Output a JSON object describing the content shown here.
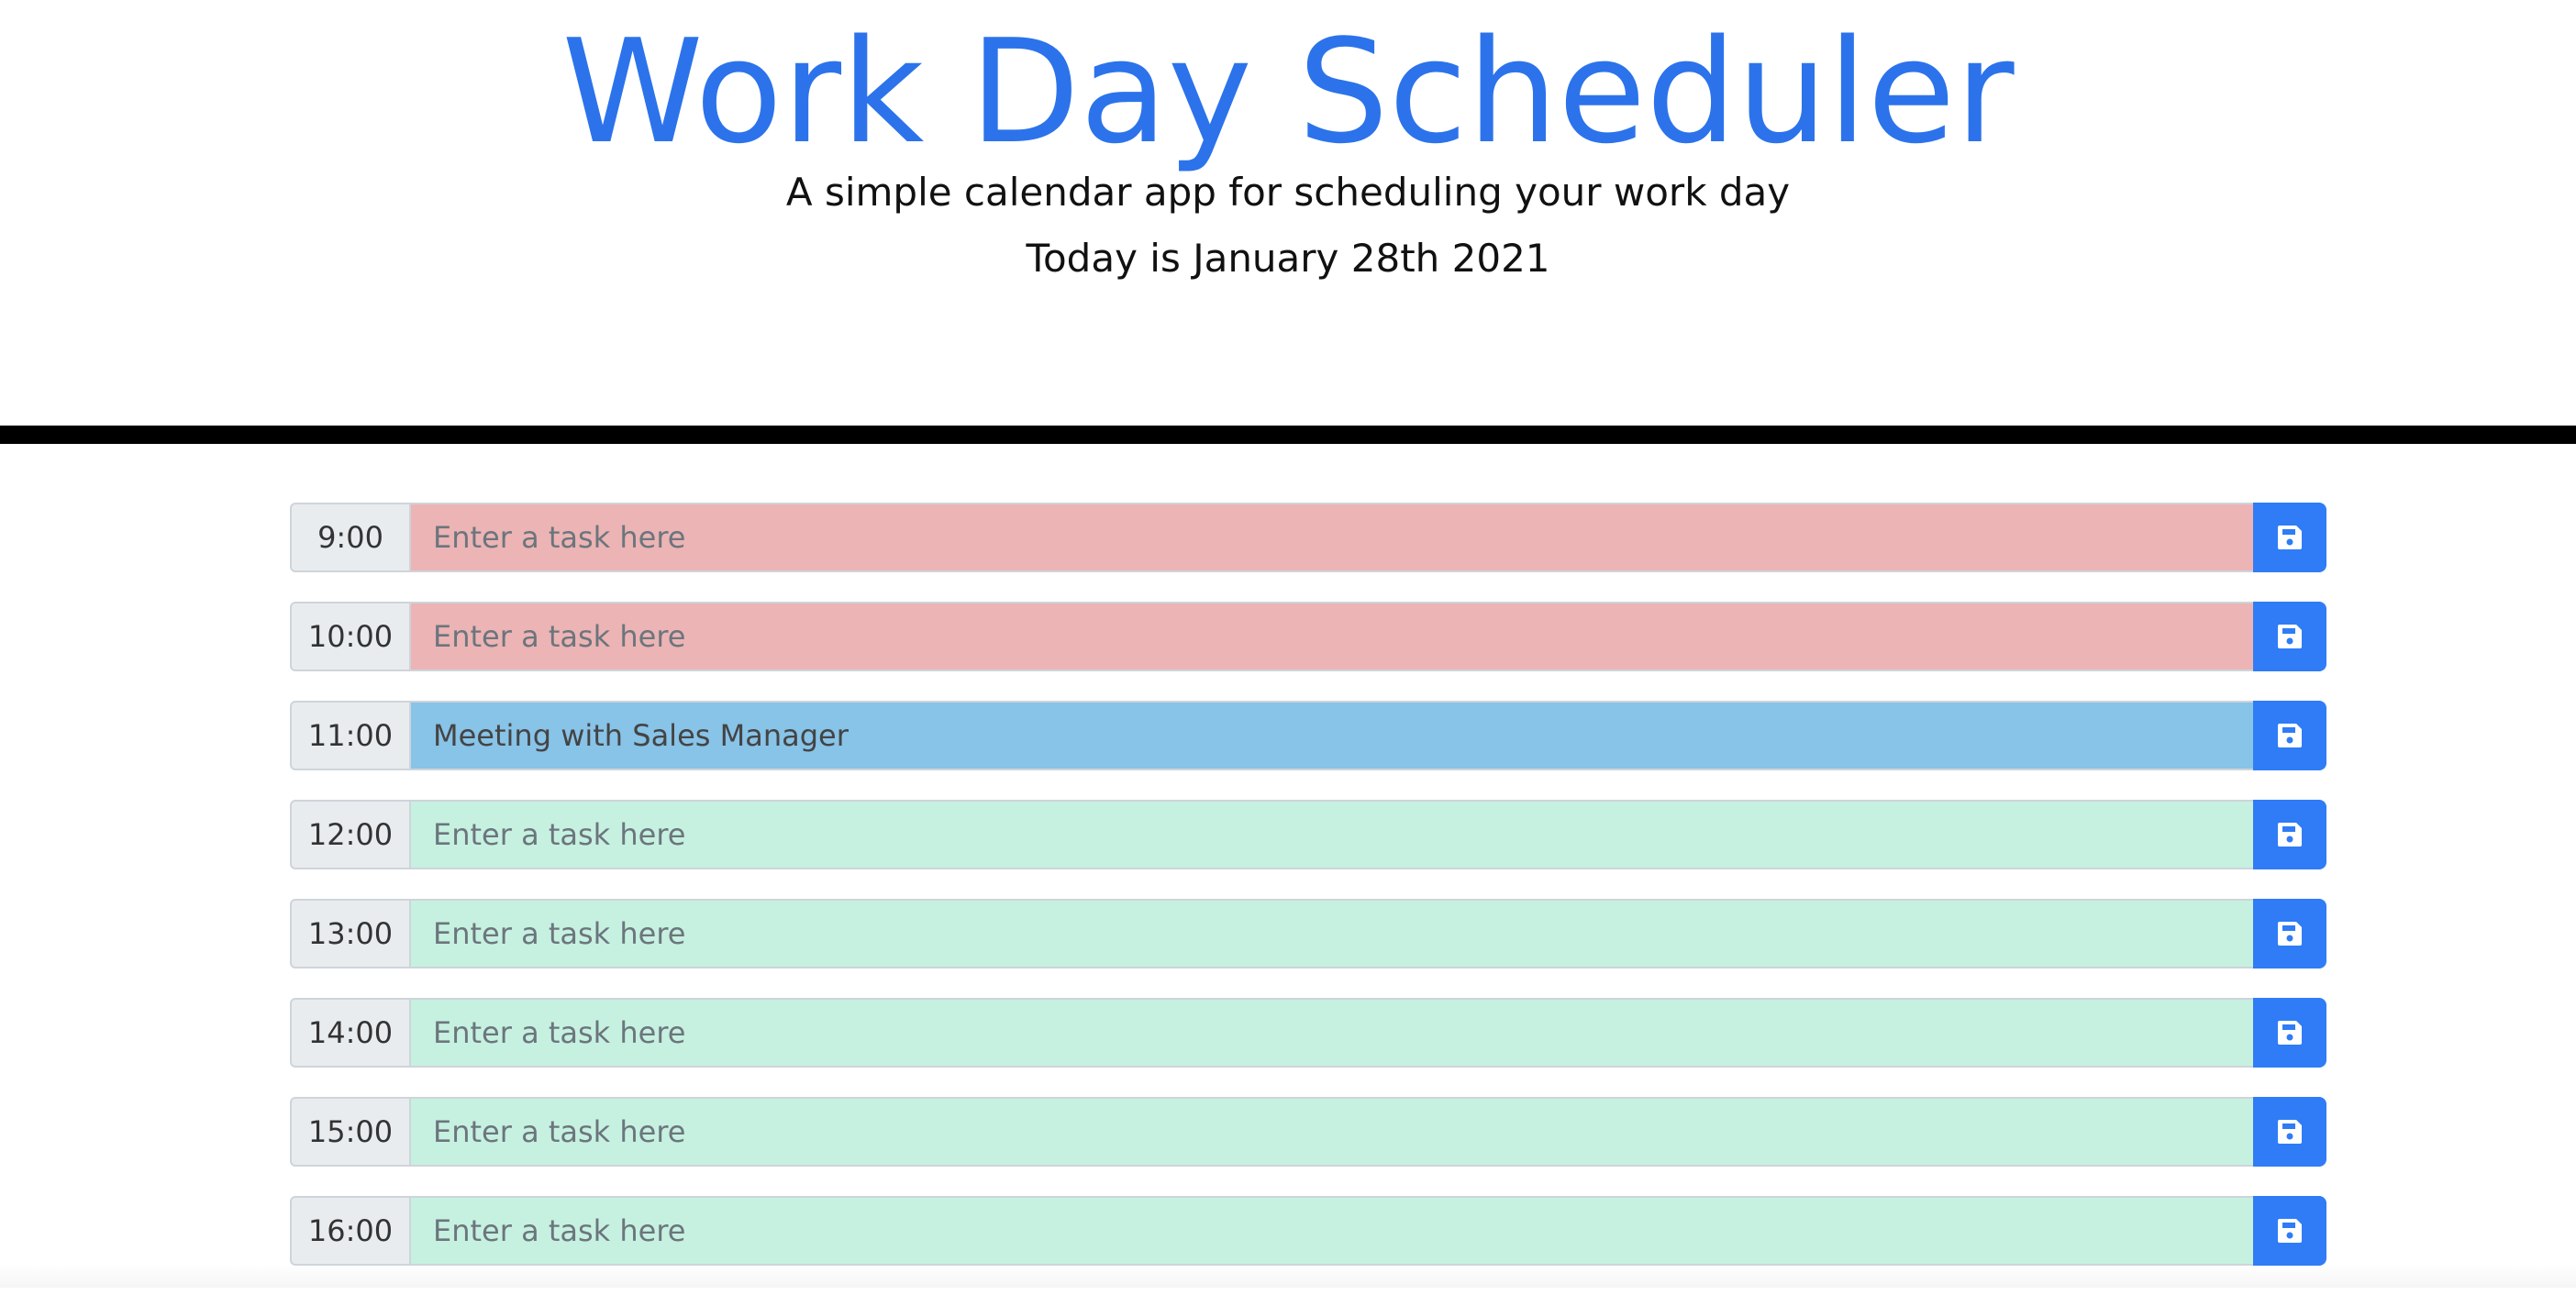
{
  "header": {
    "title": "Work Day Scheduler",
    "subtitle": "A simple calendar app for scheduling your work day",
    "today": "Today is January 28th 2021"
  },
  "colors": {
    "title": "#2c73eb",
    "past": "#ecb4b4",
    "present": "#88c3e8",
    "future": "#c6f1e0",
    "save_button": "#2f7cf6"
  },
  "rows": [
    {
      "hour": "9:00",
      "value": "",
      "placeholder": "Enter a task here",
      "state": "past",
      "save_icon": "floppy-disk-icon"
    },
    {
      "hour": "10:00",
      "value": "",
      "placeholder": "Enter a task here",
      "state": "past",
      "save_icon": "floppy-disk-icon"
    },
    {
      "hour": "11:00",
      "value": "Meeting with Sales Manager",
      "placeholder": "Enter a task here",
      "state": "present",
      "save_icon": "floppy-disk-icon"
    },
    {
      "hour": "12:00",
      "value": "",
      "placeholder": "Enter a task here",
      "state": "future",
      "save_icon": "floppy-disk-icon"
    },
    {
      "hour": "13:00",
      "value": "",
      "placeholder": "Enter a task here",
      "state": "future",
      "save_icon": "floppy-disk-icon"
    },
    {
      "hour": "14:00",
      "value": "",
      "placeholder": "Enter a task here",
      "state": "future",
      "save_icon": "floppy-disk-icon"
    },
    {
      "hour": "15:00",
      "value": "",
      "placeholder": "Enter a task here",
      "state": "future",
      "save_icon": "floppy-disk-icon"
    },
    {
      "hour": "16:00",
      "value": "",
      "placeholder": "Enter a task here",
      "state": "future",
      "save_icon": "floppy-disk-icon"
    }
  ]
}
